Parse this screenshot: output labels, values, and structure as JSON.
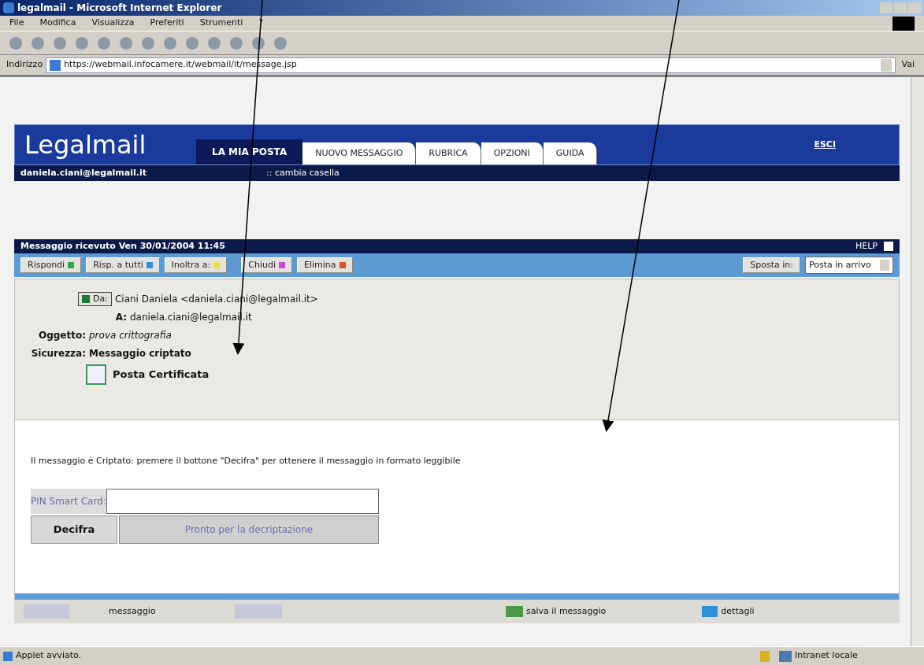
{
  "window": {
    "title": "legalmail - Microsoft Internet Explorer"
  },
  "menu": [
    "File",
    "Modifica",
    "Visualizza",
    "Preferiti",
    "Strumenti",
    "?"
  ],
  "address": {
    "label": "Indirizzo",
    "url": "https://webmail.infocamere.it/webmail/it/message.jsp",
    "go": "Vai"
  },
  "site": {
    "logo": "Legalmail",
    "user": "daniela.ciani@legalmail.it",
    "switch": ":: cambia casella",
    "logout": "ESCI",
    "tabs": [
      {
        "label": "LA MIA POSTA",
        "selected": true
      },
      {
        "label": "NUOVO MESSAGGIO",
        "selected": false
      },
      {
        "label": "RUBRICA",
        "selected": false
      },
      {
        "label": "OPZIONI",
        "selected": false
      },
      {
        "label": "GUIDA",
        "selected": false
      }
    ]
  },
  "message": {
    "title": "Messaggio ricevuto Ven 30/01/2004 11:45",
    "help": "HELP",
    "actions": [
      {
        "label": "Rispondi",
        "color": "#2fa84a"
      },
      {
        "label": "Risp. a tutti",
        "color": "#2f8fd8"
      },
      {
        "label": "Inoltra a:",
        "color": "#e8e040"
      },
      {
        "label": "Chiudi",
        "color": "#d04ad0"
      },
      {
        "label": "Elimina",
        "color": "#d85030"
      }
    ],
    "move_label": "Sposta in:",
    "folder": "Posta in arrivo",
    "from_label": "Da:",
    "from": "Ciani Daniela <daniela.ciani@legalmail.it>",
    "to_label": "A:",
    "to": "daniela.ciani@legalmail.it",
    "subject_label": "Oggetto:",
    "subject": "prova crittografia",
    "security_label": "Sicurezza:",
    "security": "Messaggio criptato",
    "certified": "Posta Certificata",
    "notice": "Il messaggio è Criptato: premere il bottone \"Decifra\" per ottenere il messaggio in formato leggibile",
    "pin_label": "PIN Smart Card:",
    "decrypt": "Decifra",
    "decrypt_status": "Pronto per la decriptazione",
    "nav_label": "messaggio",
    "save": "salva il messaggio",
    "details": "dettagli"
  },
  "status_bar": {
    "text": "Applet avviato.",
    "zone": "Intranet locale"
  }
}
